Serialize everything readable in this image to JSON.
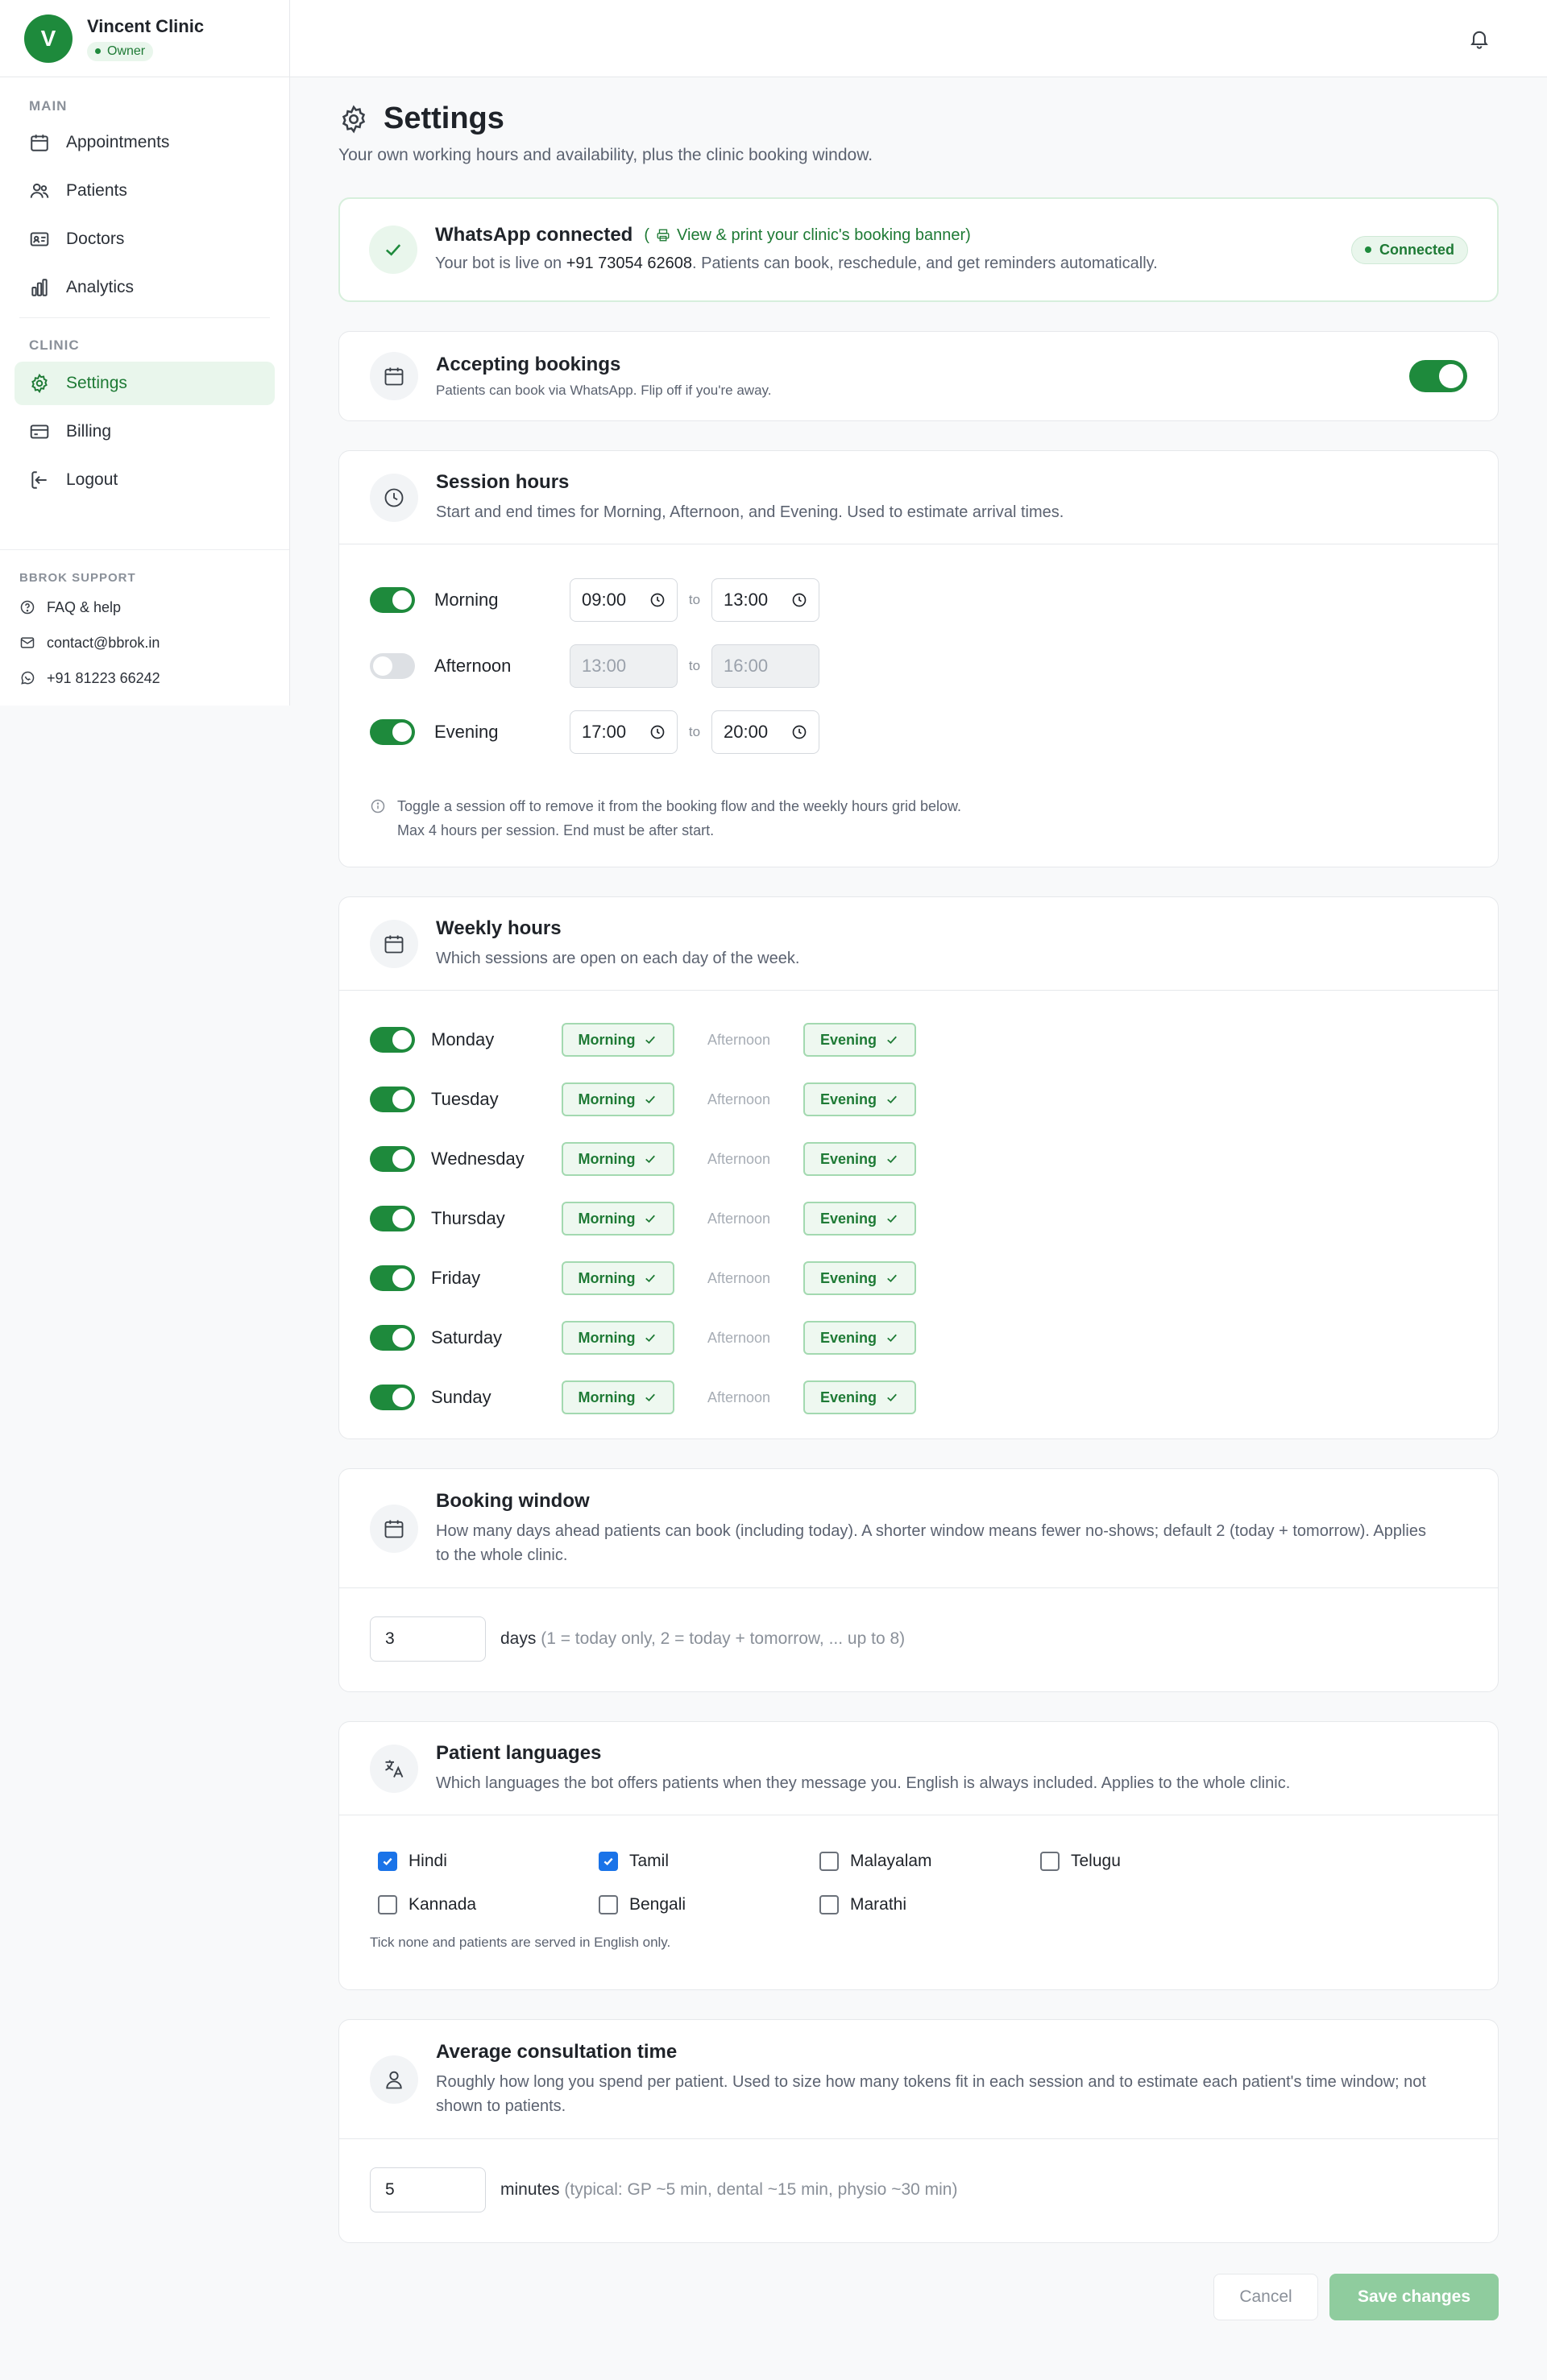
{
  "clinic": {
    "avatar_letter": "V",
    "name": "Vincent Clinic",
    "role": "Owner"
  },
  "sidebar": {
    "main_label": "MAIN",
    "clinic_label": "CLINIC",
    "items": [
      {
        "label": "Appointments",
        "icon": "calendar-icon"
      },
      {
        "label": "Patients",
        "icon": "users-icon"
      },
      {
        "label": "Doctors",
        "icon": "id-card-icon"
      },
      {
        "label": "Analytics",
        "icon": "bar-chart-icon"
      },
      {
        "label": "Settings",
        "icon": "gear-icon",
        "active": true
      },
      {
        "label": "Billing",
        "icon": "credit-card-icon"
      },
      {
        "label": "Logout",
        "icon": "logout-icon"
      }
    ],
    "support_label": "BBROK SUPPORT",
    "support": [
      {
        "label": "FAQ & help",
        "icon": "help-circle-icon"
      },
      {
        "label": "contact@bbrok.in",
        "icon": "mail-icon"
      },
      {
        "label": "+91 81223 66242",
        "icon": "whatsapp-icon"
      }
    ]
  },
  "header": {
    "notifications_icon": "bell-icon"
  },
  "page": {
    "title": "Settings",
    "subtitle": "Your own working hours and availability, plus the clinic booking window."
  },
  "whatsapp": {
    "title": "WhatsApp connected",
    "banner_open": "(",
    "banner_link": "View & print your clinic's booking banner)",
    "desc_prefix": "Your bot is live on ",
    "phone": "+91 73054 62608",
    "desc_suffix": ". Patients can book, reschedule, and get reminders automatically.",
    "status": "Connected"
  },
  "bookings": {
    "title": "Accepting bookings",
    "desc": "Patients can book via WhatsApp. Flip off if you're away.",
    "enabled": true
  },
  "sessions": {
    "title": "Session hours",
    "desc": "Start and end times for Morning, Afternoon, and Evening. Used to estimate arrival times.",
    "to_label": "to",
    "rows": [
      {
        "name": "Morning",
        "enabled": true,
        "start": "09:00",
        "end": "13:00"
      },
      {
        "name": "Afternoon",
        "enabled": false,
        "start": "13:00",
        "end": "16:00"
      },
      {
        "name": "Evening",
        "enabled": true,
        "start": "17:00",
        "end": "20:00"
      }
    ],
    "hint_line1": "Toggle a session off to remove it from the booking flow and the weekly hours grid below.",
    "hint_line2": "Max 4 hours per session. End must be after start."
  },
  "weekly": {
    "title": "Weekly hours",
    "desc": "Which sessions are open on each day of the week.",
    "session_labels": [
      "Morning",
      "Afternoon",
      "Evening"
    ],
    "days": [
      {
        "name": "Monday",
        "enabled": true
      },
      {
        "name": "Tuesday",
        "enabled": true
      },
      {
        "name": "Wednesday",
        "enabled": true
      },
      {
        "name": "Thursday",
        "enabled": true
      },
      {
        "name": "Friday",
        "enabled": true
      },
      {
        "name": "Saturday",
        "enabled": true
      },
      {
        "name": "Sunday",
        "enabled": true
      }
    ]
  },
  "booking_window": {
    "title": "Booking window",
    "desc": "How many days ahead patients can book (including today). A shorter window means fewer no-shows; default 2 (today + tomorrow). Applies to the whole clinic.",
    "value": "3",
    "unit": "days",
    "hint": "(1 = today only, 2 = today + tomorrow, ... up to 8)"
  },
  "languages": {
    "title": "Patient languages",
    "desc": "Which languages the bot offers patients when they message you. English is always included. Applies to the whole clinic.",
    "options": [
      {
        "label": "Hindi",
        "checked": true
      },
      {
        "label": "Tamil",
        "checked": true
      },
      {
        "label": "Malayalam",
        "checked": false
      },
      {
        "label": "Telugu",
        "checked": false
      },
      {
        "label": "Kannada",
        "checked": false
      },
      {
        "label": "Bengali",
        "checked": false
      },
      {
        "label": "Marathi",
        "checked": false
      }
    ],
    "hint": "Tick none and patients are served in English only."
  },
  "consultation": {
    "title": "Average consultation time",
    "desc": "Roughly how long you spend per patient. Used to size how many tokens fit in each session and to estimate each patient's time window; not shown to patients.",
    "value": "5",
    "unit": "minutes",
    "hint": "(typical: GP ~5 min, dental ~15 min, physio ~30 min)"
  },
  "actions": {
    "cancel": "Cancel",
    "save": "Save changes"
  },
  "colors": {
    "accent": "#1e8a3c",
    "accent_light": "#e9f6ec",
    "checkbox": "#1a73e8",
    "save_disabled": "#8fcc9e"
  }
}
